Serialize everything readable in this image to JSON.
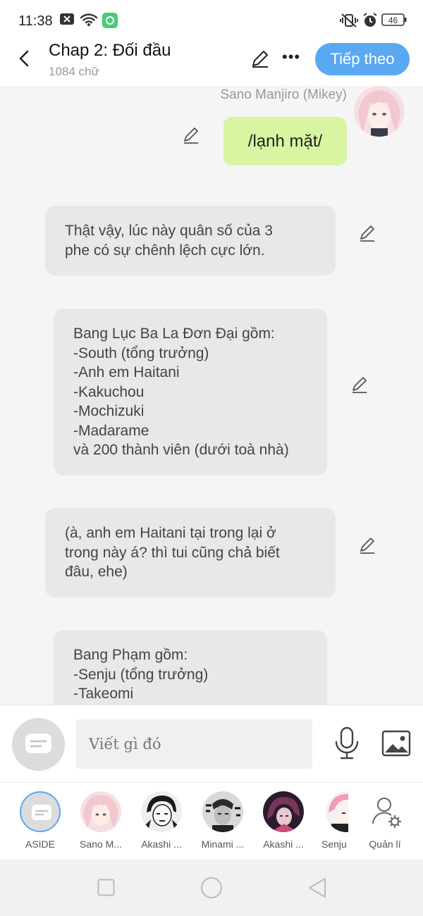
{
  "status": {
    "time": "11:38",
    "battery": "46"
  },
  "header": {
    "title": "Chap 2: Đối đầu",
    "subtitle": "1084 chữ",
    "next_label": "Tiếp theo"
  },
  "messages": [
    {
      "type": "character",
      "speaker": "Sano Manjiro (Mikey)",
      "text": "/lạnh mặt/"
    },
    {
      "type": "narration",
      "text": "Thật vậy, lúc này quân số của 3\nphe có sự chênh lệch cực lớn."
    },
    {
      "type": "narration",
      "text": "Bang Lục Ba La Đơn Đại gồm:\n-South (tổng trưởng)\n-Anh em Haitani\n-Kakuchou\n-Mochizuki\n-Madarame\nvà 200 thành viên (dưới toà nhà)"
    },
    {
      "type": "narration",
      "text": "(à, anh em Haitani tại trong lại ở\ntrong này á? thì tui cũng chả biết\nđâu, ehe)"
    },
    {
      "type": "narration",
      "text": "Bang Phạm gồm:\n-Senju (tổng trưởng)\n-Takeomi"
    }
  ],
  "composer": {
    "placeholder": "Viết gì đó"
  },
  "characters": [
    {
      "label": "ASIDE"
    },
    {
      "label": "Sano M..."
    },
    {
      "label": "Akashi ..."
    },
    {
      "label": "Minami ..."
    },
    {
      "label": "Akashi ..."
    },
    {
      "label": "Senju"
    },
    {
      "label": "Quản lí"
    }
  ],
  "colors": {
    "accent": "#5aa8f2",
    "user_bubble": "#d8f5a2",
    "narration_bubble": "#e8e8e8"
  },
  "icons": [
    "back-arrow-icon",
    "pencil-icon",
    "more-icon",
    "chat-icon",
    "mic-icon",
    "image-icon",
    "user-settings-icon",
    "square-icon",
    "circle-icon",
    "triangle-back-icon"
  ]
}
